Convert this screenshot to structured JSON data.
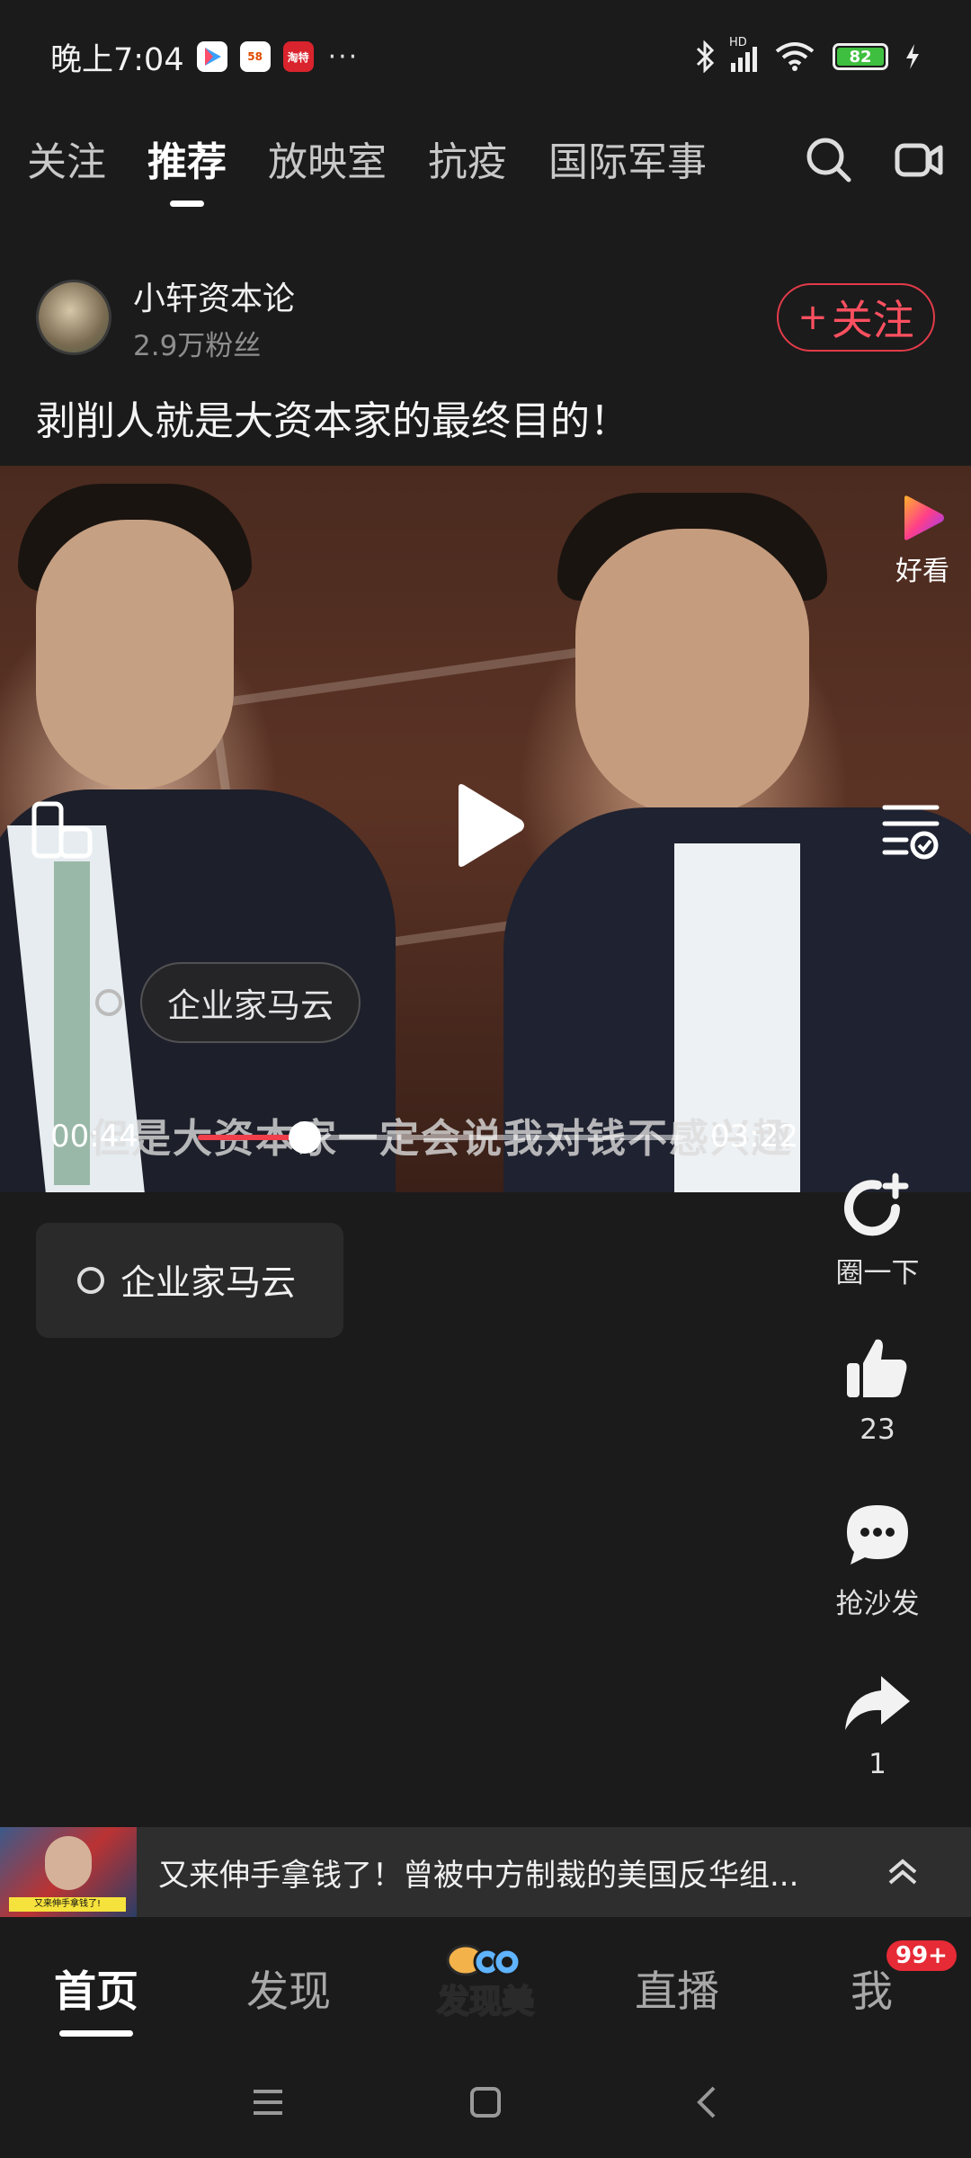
{
  "status_bar": {
    "time": "晚上7:04",
    "app_icons": [
      "video-app-icon",
      "58-app-icon",
      "taote-app-icon"
    ],
    "app_labels": [
      "",
      "58",
      "淘特"
    ],
    "more": "···",
    "network": "HD",
    "battery": "82"
  },
  "top_tabs": [
    "关注",
    "推荐",
    "放映室",
    "抗疫",
    "国际军事"
  ],
  "active_tab": 1,
  "author": {
    "name": "小轩资本论",
    "fans": "2.9万粉丝",
    "follow_label": "关注",
    "follow_plus": "+"
  },
  "post": {
    "title": "剥削人就是大资本家的最终目的！"
  },
  "video": {
    "brand_label": "好看",
    "tag": "企业家马云",
    "subtitle": "但是大资本家一定会说我对钱不感兴趣",
    "current_time": "00:44",
    "total_time": "03:22",
    "progress": 0.22
  },
  "topic": {
    "label": "企业家马云"
  },
  "rail": {
    "share_circle": "圈一下",
    "likes": "23",
    "comment": "抢沙发",
    "shares": "1"
  },
  "next_video": {
    "title": "又来伸手拿钱了！曾被中方制裁的美国反华组...",
    "thumb_caption": "又来伸手拿钱了!"
  },
  "bottom_nav": {
    "home": "首页",
    "discover": "发现",
    "center_logo": "发现美",
    "live": "直播",
    "me": "我",
    "badge": "99+"
  },
  "colors": {
    "accent_red": "#e23b4a",
    "background": "#1b1b1b"
  }
}
